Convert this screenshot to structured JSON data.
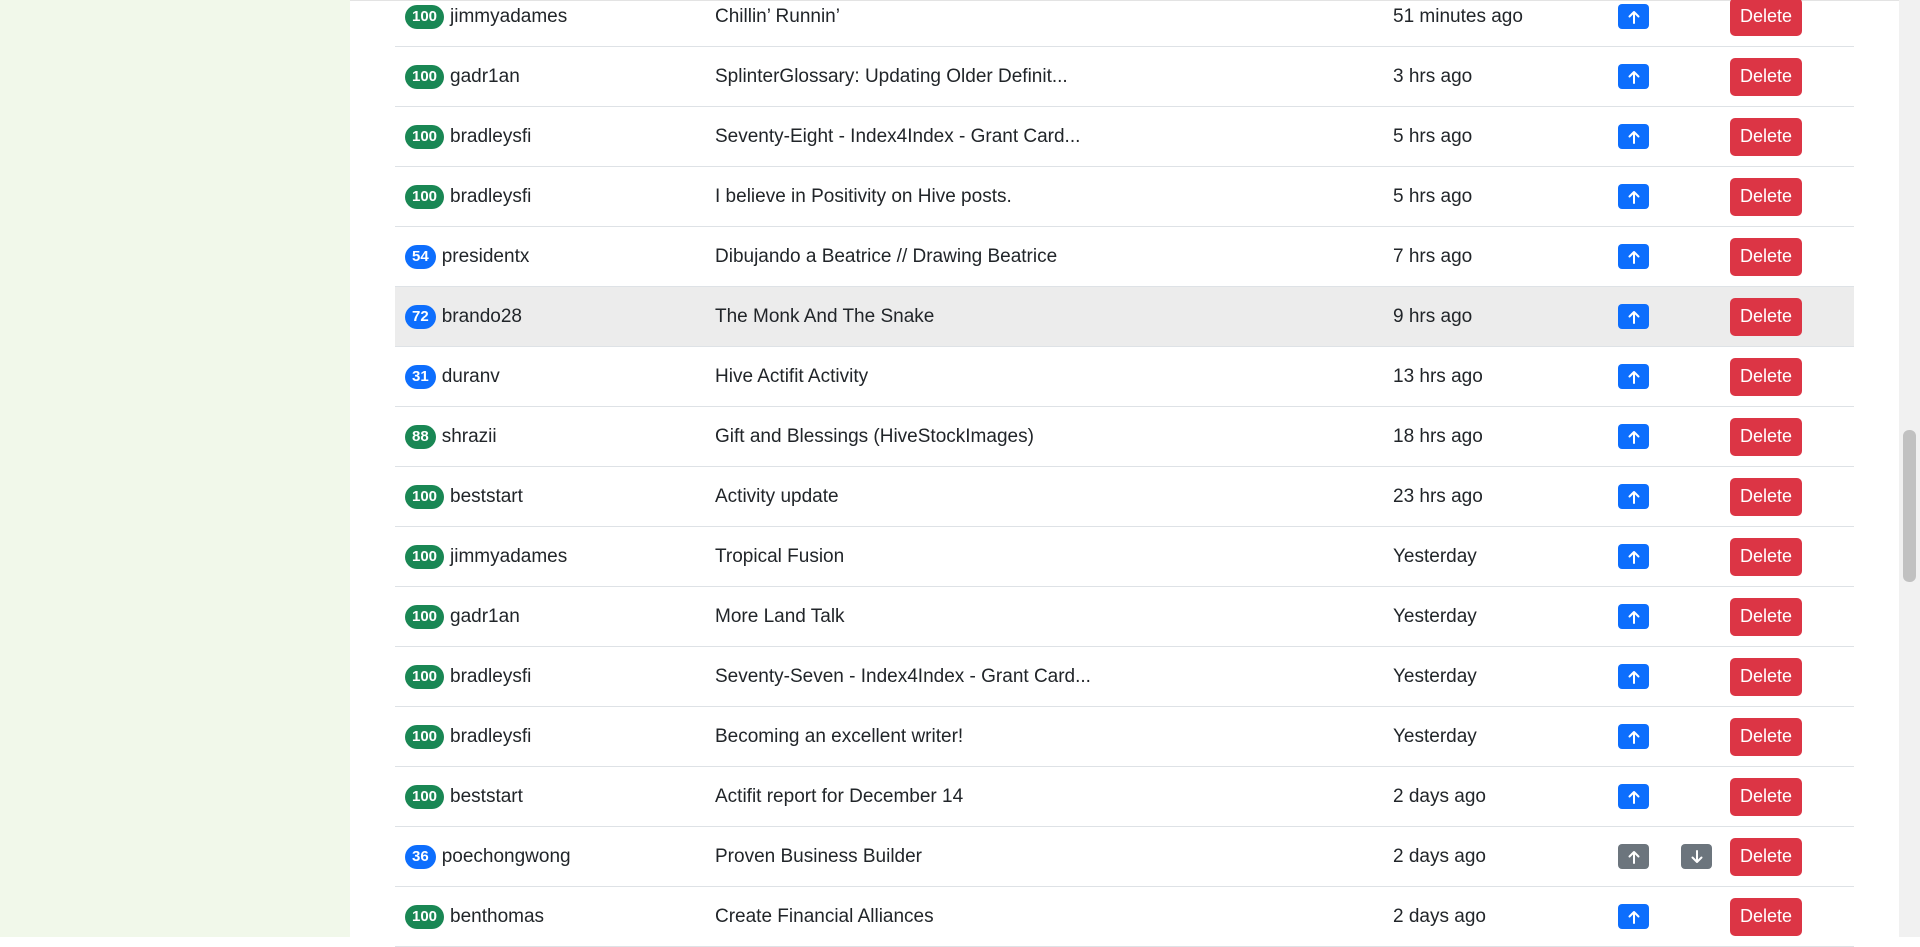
{
  "actions": {
    "delete_label": "Delete"
  },
  "rows": [
    {
      "score": "100",
      "author": "jimmyadames",
      "title": "Chillin’ Runnin’",
      "time": "51 minutes ago"
    },
    {
      "score": "100",
      "author": "gadr1an",
      "title": "SplinterGlossary: Updating Older Definit...",
      "time": "3 hrs ago"
    },
    {
      "score": "100",
      "author": "bradleysfi",
      "title": "Seventy-Eight - Index4Index - Grant Card...",
      "time": "5 hrs ago"
    },
    {
      "score": "100",
      "author": "bradleysfi",
      "title": "I believe in Positivity on Hive posts.",
      "time": "5 hrs ago"
    },
    {
      "score": "54",
      "author": "presidentx",
      "title": "Dibujando a Beatrice // Drawing Beatrice",
      "time": "7 hrs ago"
    },
    {
      "score": "72",
      "author": "brando28",
      "title": "The Monk And The Snake",
      "time": "9 hrs ago"
    },
    {
      "score": "31",
      "author": "duranv",
      "title": "Hive Actifit Activity",
      "time": "13 hrs ago"
    },
    {
      "score": "88",
      "author": "shrazii",
      "title": "Gift and Blessings (HiveStockImages)",
      "time": "18 hrs ago"
    },
    {
      "score": "100",
      "author": "beststart",
      "title": "Activity update",
      "time": "23 hrs ago"
    },
    {
      "score": "100",
      "author": "jimmyadames",
      "title": "Tropical Fusion",
      "time": "Yesterday"
    },
    {
      "score": "100",
      "author": "gadr1an",
      "title": "More Land Talk",
      "time": "Yesterday"
    },
    {
      "score": "100",
      "author": "bradleysfi",
      "title": "Seventy-Seven - Index4Index - Grant Card...",
      "time": "Yesterday"
    },
    {
      "score": "100",
      "author": "bradleysfi",
      "title": "Becoming an excellent writer!",
      "time": "Yesterday"
    },
    {
      "score": "100",
      "author": "beststart",
      "title": "Actifit report for December 14",
      "time": "2 days ago"
    },
    {
      "score": "36",
      "author": "poechongwong",
      "title": "Proven Business Builder",
      "time": "2 days ago"
    },
    {
      "score": "100",
      "author": "benthomas",
      "title": "Create Financial Alliances",
      "time": "2 days ago"
    }
  ],
  "colors": {
    "badge_green": "#198754",
    "badge_blue": "#0d6efd",
    "upvote_active": "#0d6efd",
    "vote_inactive": "#6c757d",
    "delete": "#dc3545",
    "left_panel": "#f1f8ea",
    "highlight_row": "#ececec"
  },
  "icons": {
    "upvote": "arrow-up-icon",
    "downvote": "arrow-down-icon"
  }
}
